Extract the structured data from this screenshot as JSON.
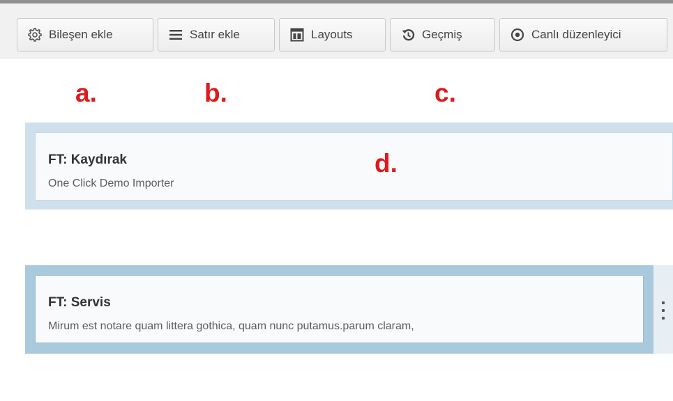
{
  "toolbar": {
    "buttons": [
      {
        "label": "Bileşen ekle",
        "icon": "gear-icon"
      },
      {
        "label": "Satır ekle",
        "icon": "lines-icon"
      },
      {
        "label": "Layouts",
        "icon": "layout-icon"
      },
      {
        "label": "Geçmiş",
        "icon": "history-icon"
      },
      {
        "label": "Canlı düzenleyici",
        "icon": "eye-icon"
      }
    ]
  },
  "annotations": {
    "a": "a.",
    "b": "b.",
    "c": "c.",
    "d": "d."
  },
  "rows": [
    {
      "title": "FT: Kaydırak",
      "subtitle": "One Click Demo Importer"
    },
    {
      "title": "FT: Servis",
      "subtitle": "Mirum est notare quam littera gothica, quam nunc putamus.parum claram,"
    }
  ],
  "colors": {
    "annotation": "#e0191c",
    "row_light": "#cfe0ec",
    "row_selected": "#a9c9dc"
  }
}
